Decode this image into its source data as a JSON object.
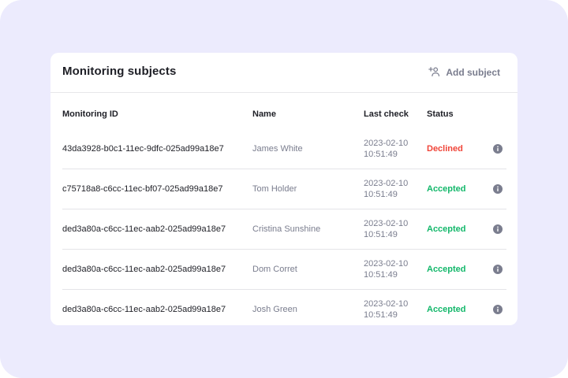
{
  "panel": {
    "title": "Monitoring subjects",
    "add_label": "Add subject"
  },
  "table": {
    "headers": {
      "id": "Monitoring ID",
      "name": "Name",
      "last_check": "Last check",
      "status": "Status"
    },
    "rows": [
      {
        "id": "43da3928-b0c1-11ec-9dfc-025ad99a18e7",
        "name": "James White",
        "date": "2023-02-10",
        "time": "10:51:49",
        "status": "Declined"
      },
      {
        "id": "c75718a8-c6cc-11ec-bf07-025ad99a18e7",
        "name": "Tom Holder",
        "date": "2023-02-10",
        "time": "10:51:49",
        "status": "Accepted"
      },
      {
        "id": "ded3a80a-c6cc-11ec-aab2-025ad99a18e7",
        "name": "Cristina Sunshine",
        "date": "2023-02-10",
        "time": "10:51:49",
        "status": "Accepted"
      },
      {
        "id": "ded3a80a-c6cc-11ec-aab2-025ad99a18e7",
        "name": "Dom Corret",
        "date": "2023-02-10",
        "time": "10:51:49",
        "status": "Accepted"
      },
      {
        "id": "ded3a80a-c6cc-11ec-aab2-025ad99a18e7",
        "name": "Josh Green",
        "date": "2023-02-10",
        "time": "10:51:49",
        "status": "Accepted"
      }
    ]
  },
  "colors": {
    "background": "#ecebfd",
    "declined": "#f04438",
    "accepted": "#12b76a",
    "muted": "#7a7d8e",
    "text": "#1e1f26"
  },
  "icons": {
    "add": "add-user-icon",
    "info": "info-icon"
  }
}
